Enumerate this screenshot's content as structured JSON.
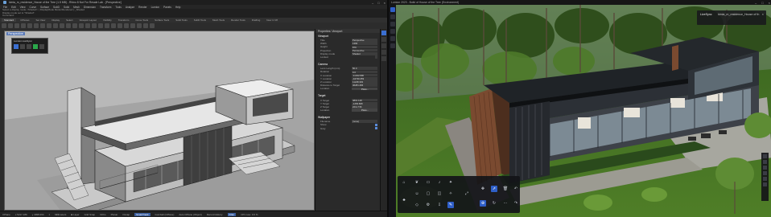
{
  "rhino": {
    "title": "kimla_m_residence_House of the Tree (1.5 MB) - Rhino 8 Not For Resale Lab - [Perspective]",
    "menus": [
      "File",
      "Edit",
      "View",
      "Curve",
      "Surface",
      "SubD",
      "Solid",
      "Mesh",
      "Dimension",
      "Transform",
      "Tools",
      "Analyze",
      "Render",
      "Lumion",
      "Panels",
      "Help"
    ],
    "command_history": [
      "Select a display mode <Shaded> ( DisplayMode Mode=Rendered ):_Shaded",
      "Display mode set to \"Shaded\"."
    ],
    "command_prompt": "Command:",
    "tabs": [
      "Standard",
      "CPlanes",
      "Set View",
      "Display",
      "Select",
      "Viewport Layout",
      "Visibility",
      "Transform",
      "Curve Tools",
      "Surface Tools",
      "Solid Tools",
      "SubD Tools",
      "Mesh Tools",
      "Render Tools",
      "Drafting",
      "New in V8"
    ],
    "viewport_label": "Perspective",
    "lumion_panel_title": "Lumion LiveSync",
    "properties": {
      "header": "Properties: Viewport",
      "viewport_section": "Viewport",
      "viewport_rows": [
        {
          "key": "Title",
          "value": "Perspective"
        },
        {
          "key": "Width",
          "value": "1366"
        },
        {
          "key": "Height",
          "value": "879"
        },
        {
          "key": "Projection",
          "value": "Perspective"
        },
        {
          "key": "Display mode",
          "value": "Shaded"
        },
        {
          "key": "Locked",
          "value": ""
        }
      ],
      "camera_section": "Camera",
      "camera_rows": [
        {
          "key": "Lens Length (mm)",
          "value": "50.0"
        },
        {
          "key": "Rotation",
          "value": "0.0"
        },
        {
          "key": "X Location",
          "value": "-11042.896"
        },
        {
          "key": "Y Location",
          "value": "-42739.359"
        },
        {
          "key": "Z Location",
          "value": "11248.303"
        },
        {
          "key": "Distance to Target",
          "value": "46281.484"
        },
        {
          "key": "Location",
          "value": "Place..."
        }
      ],
      "target_section": "Target",
      "target_rows": [
        {
          "key": "X Target",
          "value": "4801.148"
        },
        {
          "key": "Y Target",
          "value": "-1256.808"
        },
        {
          "key": "Z Target",
          "value": "2211.736"
        },
        {
          "key": "Location",
          "value": "Place..."
        }
      ],
      "wallpaper_section": "Wallpaper",
      "wallpaper_rows": [
        {
          "key": "Filename",
          "value": "(none)"
        },
        {
          "key": "Show",
          "value": ""
        },
        {
          "key": "Gray",
          "value": ""
        }
      ]
    },
    "status": {
      "plane": "CPlane",
      "x": "x 5217.189",
      "y": "y 4998.264",
      "z": "z",
      "units": "Millimeters",
      "layer": "■ Layer",
      "items": [
        "Grid Snap",
        "Ortho",
        "Planar",
        "Osnap",
        "SmartTrack",
        "Gumball (CPlane)",
        "Auto CPlane (Object)",
        "Record History",
        "Filter",
        "CPU use: 0.6 %"
      ],
      "highlight": [
        "SmartTrack",
        "Filter"
      ]
    }
  },
  "lumion": {
    "title": "Lumion 2023 - Build of House of the Tree (Environment)",
    "livesync_label": "LiveSync",
    "livesync_file": "kimla_m_residence_House of th",
    "close_glyph": "×",
    "accent": "#2f5fc8"
  },
  "window_buttons": {
    "minimize": "–",
    "maximize": "□",
    "close": "×"
  }
}
